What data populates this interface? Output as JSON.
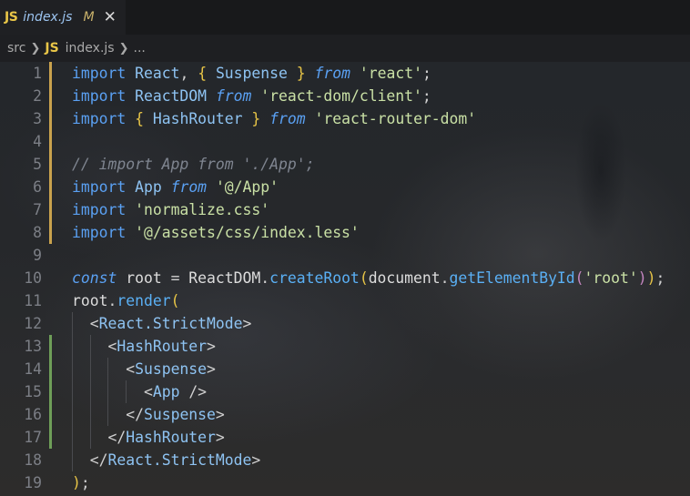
{
  "tab": {
    "icon_text": "JS",
    "name": "index.js",
    "modified": "M",
    "close": "✕"
  },
  "breadcrumb": {
    "folder": "src",
    "file_icon": "JS",
    "file": "index.js",
    "more": "..."
  },
  "colors": {
    "keyword": "#5aa0f2",
    "identifier": "#8ec3f2",
    "string": "#c9e0a5",
    "comment": "#7f8590",
    "bracket": "#e8c547",
    "modified_gutter": "#c9a24d",
    "added_gutter": "#6e9e58"
  },
  "lines": [
    {
      "n": "1",
      "mark": "modified",
      "tokens": [
        [
          "kw",
          "import"
        ],
        [
          "plain",
          " "
        ],
        [
          "id",
          "React"
        ],
        [
          "pun",
          ", "
        ],
        [
          "brace",
          "{"
        ],
        [
          "plain",
          " "
        ],
        [
          "id",
          "Suspense"
        ],
        [
          "plain",
          " "
        ],
        [
          "brace",
          "}"
        ],
        [
          "plain",
          " "
        ],
        [
          "it",
          "from"
        ],
        [
          "plain",
          " "
        ],
        [
          "str",
          "'react'"
        ],
        [
          "pun",
          ";"
        ]
      ]
    },
    {
      "n": "2",
      "mark": "modified",
      "tokens": [
        [
          "kw",
          "import"
        ],
        [
          "plain",
          " "
        ],
        [
          "id",
          "ReactDOM"
        ],
        [
          "plain",
          " "
        ],
        [
          "it",
          "from"
        ],
        [
          "plain",
          " "
        ],
        [
          "str",
          "'react-dom/client'"
        ],
        [
          "pun",
          ";"
        ]
      ]
    },
    {
      "n": "3",
      "mark": "modified",
      "tokens": [
        [
          "kw",
          "import"
        ],
        [
          "plain",
          " "
        ],
        [
          "brace",
          "{"
        ],
        [
          "plain",
          " "
        ],
        [
          "id",
          "HashRouter"
        ],
        [
          "plain",
          " "
        ],
        [
          "brace",
          "}"
        ],
        [
          "plain",
          " "
        ],
        [
          "it",
          "from"
        ],
        [
          "plain",
          " "
        ],
        [
          "str",
          "'react-router-dom'"
        ]
      ]
    },
    {
      "n": "4",
      "mark": "modified",
      "tokens": []
    },
    {
      "n": "5",
      "mark": "modified",
      "tokens": [
        [
          "cm",
          "// import App from './App';"
        ]
      ]
    },
    {
      "n": "6",
      "mark": "modified",
      "tokens": [
        [
          "kw",
          "import"
        ],
        [
          "plain",
          " "
        ],
        [
          "id",
          "App"
        ],
        [
          "plain",
          " "
        ],
        [
          "it",
          "from"
        ],
        [
          "plain",
          " "
        ],
        [
          "str",
          "'@/App'"
        ]
      ]
    },
    {
      "n": "7",
      "mark": "modified",
      "tokens": [
        [
          "kw",
          "import"
        ],
        [
          "plain",
          " "
        ],
        [
          "str",
          "'normalize.css'"
        ]
      ]
    },
    {
      "n": "8",
      "mark": "modified",
      "tokens": [
        [
          "kw",
          "import"
        ],
        [
          "plain",
          " "
        ],
        [
          "str",
          "'@/assets/css/index.less'"
        ]
      ]
    },
    {
      "n": "9",
      "mark": "",
      "tokens": []
    },
    {
      "n": "10",
      "mark": "",
      "tokens": [
        [
          "it",
          "const"
        ],
        [
          "plain",
          " root "
        ],
        [
          "op",
          "="
        ],
        [
          "plain",
          " ReactDOM"
        ],
        [
          "pun",
          "."
        ],
        [
          "fn",
          "createRoot"
        ],
        [
          "brace",
          "("
        ],
        [
          "plain",
          "document"
        ],
        [
          "pun",
          "."
        ],
        [
          "fn",
          "getElementById"
        ],
        [
          "paren2",
          "("
        ],
        [
          "str",
          "'root'"
        ],
        [
          "paren2",
          ")"
        ],
        [
          "brace",
          ")"
        ],
        [
          "pun",
          ";"
        ]
      ]
    },
    {
      "n": "11",
      "mark": "",
      "tokens": [
        [
          "plain",
          "root"
        ],
        [
          "pun",
          "."
        ],
        [
          "fn",
          "render"
        ],
        [
          "brace",
          "("
        ]
      ]
    },
    {
      "n": "12",
      "mark": "",
      "tokens": [
        [
          "plain",
          "  "
        ],
        [
          "pun",
          "<"
        ],
        [
          "tag",
          "React.StrictMode"
        ],
        [
          "pun",
          ">"
        ]
      ]
    },
    {
      "n": "13",
      "mark": "added",
      "tokens": [
        [
          "plain",
          "    "
        ],
        [
          "pun",
          "<"
        ],
        [
          "tag",
          "HashRouter"
        ],
        [
          "pun",
          ">"
        ]
      ]
    },
    {
      "n": "14",
      "mark": "added",
      "tokens": [
        [
          "plain",
          "      "
        ],
        [
          "pun",
          "<"
        ],
        [
          "tag",
          "Suspense"
        ],
        [
          "pun",
          ">"
        ]
      ]
    },
    {
      "n": "15",
      "mark": "added",
      "tokens": [
        [
          "plain",
          "        "
        ],
        [
          "pun",
          "<"
        ],
        [
          "tag",
          "App"
        ],
        [
          "plain",
          " "
        ],
        [
          "pun",
          "/>"
        ]
      ]
    },
    {
      "n": "16",
      "mark": "added",
      "tokens": [
        [
          "plain",
          "      "
        ],
        [
          "pun",
          "</"
        ],
        [
          "tag",
          "Suspense"
        ],
        [
          "pun",
          ">"
        ]
      ]
    },
    {
      "n": "17",
      "mark": "added",
      "tokens": [
        [
          "plain",
          "    "
        ],
        [
          "pun",
          "</"
        ],
        [
          "tag",
          "HashRouter"
        ],
        [
          "pun",
          ">"
        ]
      ]
    },
    {
      "n": "18",
      "mark": "",
      "tokens": [
        [
          "plain",
          "  "
        ],
        [
          "pun",
          "</"
        ],
        [
          "tag",
          "React.StrictMode"
        ],
        [
          "pun",
          ">"
        ]
      ]
    },
    {
      "n": "19",
      "mark": "",
      "tokens": [
        [
          "brace",
          ")"
        ],
        [
          "pun",
          ";"
        ]
      ]
    }
  ]
}
